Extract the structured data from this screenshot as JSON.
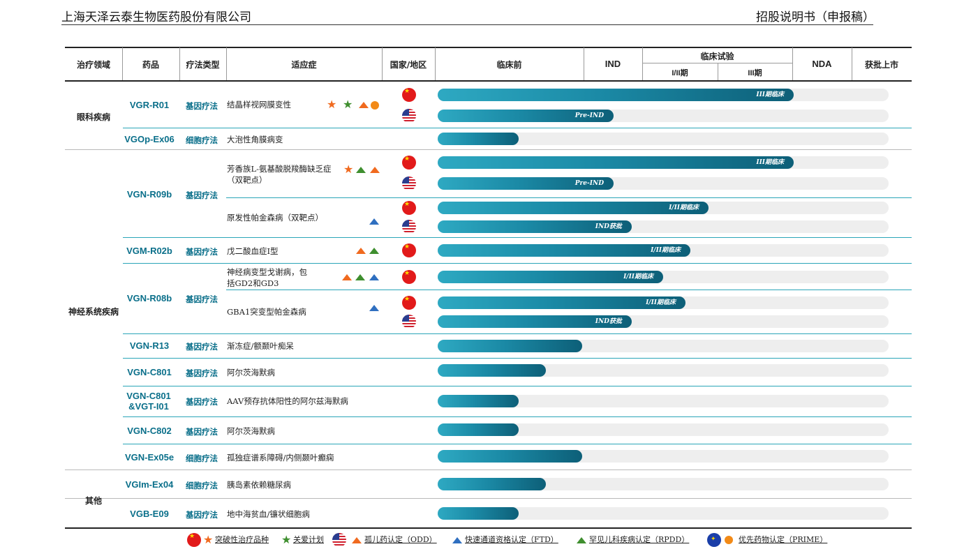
{
  "header": {
    "left": "上海天泽云泰生物医药股份有限公司",
    "right": "招股说明书（申报稿）"
  },
  "table_header": {
    "area": "治疗领域",
    "drug": "药品",
    "therapy_type": "疗法类型",
    "indication": "适应症",
    "region": "国家/地区",
    "preclinical": "临床前",
    "ind": "IND",
    "clinical_trial": "临床试验",
    "phase_1_2": "I/II期",
    "phase_3": "III期",
    "nda": "NDA",
    "approved": "获批上市"
  },
  "areas": {
    "ophthalmology": "眼科疾病",
    "neurology": "神经系统疾病",
    "other": "其他"
  },
  "rows": [
    {
      "drug": "VGR-R01",
      "therapy": "基因疗法",
      "indication": "结晶样视网膜变性",
      "markers": [
        "star-orange",
        "star-green",
        "triangle-orange",
        "circle-orange"
      ],
      "bars": [
        {
          "country": "CN",
          "progress": 0.79,
          "label": "III期临床"
        },
        {
          "country": "US",
          "progress": 0.39,
          "label": "Pre-IND"
        }
      ]
    },
    {
      "drug": "VGOp-Ex06",
      "therapy": "细胞疗法",
      "indication": "大泡性角膜病变",
      "markers": [],
      "bars": [
        {
          "country": "",
          "progress": 0.18,
          "label": ""
        }
      ]
    },
    {
      "drug": "VGN-R09b",
      "therapy": "基因疗法",
      "indication": "芳香族L-氨基酸脱羧酶缺乏症（双靶点）",
      "markers": [
        "star-orange",
        "triangle-green",
        "triangle-orange"
      ],
      "bars": [
        {
          "country": "CN",
          "progress": 0.79,
          "label": "III期临床"
        },
        {
          "country": "US",
          "progress": 0.39,
          "label": "Pre-IND"
        }
      ]
    },
    {
      "drug": "",
      "therapy": "",
      "indication": "原发性帕金森病（双靶点）",
      "markers": [
        "triangle-blue"
      ],
      "bars": [
        {
          "country": "CN",
          "progress": 0.6,
          "label": "I/II期临床"
        },
        {
          "country": "US",
          "progress": 0.43,
          "label": "IND获批"
        }
      ]
    },
    {
      "drug": "VGM-R02b",
      "therapy": "基因疗法",
      "indication": "戊二酸血症I型",
      "markers": [
        "triangle-orange",
        "triangle-green"
      ],
      "bars": [
        {
          "country": "CN",
          "progress": 0.56,
          "label": "I/II期临床"
        }
      ]
    },
    {
      "drug": "VGN-R08b",
      "therapy": "基因疗法",
      "indication": "神经病变型戈谢病，包括GD2和GD3",
      "markers": [
        "triangle-orange",
        "triangle-green",
        "triangle-blue"
      ],
      "bars": [
        {
          "country": "CN",
          "progress": 0.5,
          "label": "I/II期临床"
        }
      ]
    },
    {
      "drug": "",
      "therapy": "",
      "indication": "GBA1突变型帕金森病",
      "markers": [
        "triangle-blue"
      ],
      "bars": [
        {
          "country": "CN",
          "progress": 0.55,
          "label": "I/II期临床"
        },
        {
          "country": "US",
          "progress": 0.43,
          "label": "IND获批"
        }
      ]
    },
    {
      "drug": "VGN-R13",
      "therapy": "基因疗法",
      "indication": "渐冻症/额颞叶痴呆",
      "markers": [],
      "bars": [
        {
          "country": "",
          "progress": 0.32,
          "label": ""
        }
      ]
    },
    {
      "drug": "VGN-C801",
      "therapy": "基因疗法",
      "indication": "阿尔茨海默病",
      "markers": [],
      "bars": [
        {
          "country": "",
          "progress": 0.24,
          "label": ""
        }
      ]
    },
    {
      "drug": "VGN-C801 &VGT-I01",
      "therapy": "基因疗法",
      "indication": "AAV预存抗体阳性的阿尔兹海默病",
      "markers": [],
      "bars": [
        {
          "country": "",
          "progress": 0.18,
          "label": ""
        }
      ]
    },
    {
      "drug": "VGN-C802",
      "therapy": "基因疗法",
      "indication": "阿尔茨海默病",
      "markers": [],
      "bars": [
        {
          "country": "",
          "progress": 0.18,
          "label": ""
        }
      ]
    },
    {
      "drug": "VGN-Ex05e",
      "therapy": "细胞疗法",
      "indication": "孤独症谱系障碍/内侧颞叶癫痫",
      "markers": [],
      "bars": [
        {
          "country": "",
          "progress": 0.32,
          "label": ""
        }
      ]
    },
    {
      "drug": "VGIm-Ex04",
      "therapy": "细胞疗法",
      "indication": "胰岛素依赖糖尿病",
      "markers": [],
      "bars": [
        {
          "country": "",
          "progress": 0.24,
          "label": ""
        }
      ]
    },
    {
      "drug": "VGB-E09",
      "therapy": "基因疗法",
      "indication": "地中海贫血/镰状细胞病",
      "markers": [],
      "bars": [
        {
          "country": "",
          "progress": 0.18,
          "label": ""
        }
      ]
    }
  ],
  "legend": {
    "breakthrough": "突破性治疗品种",
    "care_program": "关爱计划",
    "odd": "孤儿药认定（ODD）",
    "ftd": "快速通道资格认定（FTD）",
    "rpdd": "罕见儿科疾病认定（RPDD）",
    "prime": "优先药物认定（PRIME）"
  },
  "colors": {
    "drug_text": "#0a6f8a",
    "bar_start": "#2ea9c2",
    "bar_end": "#0d5f78",
    "track": "#eeeeee",
    "row_rule": "#2aa5b8"
  }
}
